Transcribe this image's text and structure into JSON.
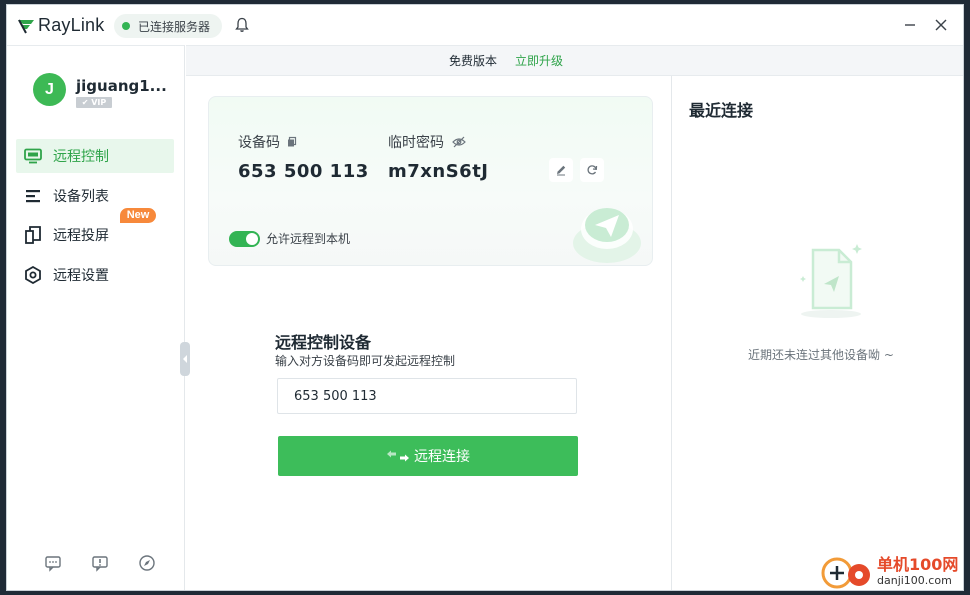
{
  "app": {
    "name": "RayLink",
    "server_status": "已连接服务器",
    "accent": "#33b454"
  },
  "user": {
    "initial": "J",
    "name": "jiguang1...",
    "vip_label": "✔ VIP"
  },
  "sidebar": {
    "items": [
      {
        "label": "远程控制",
        "icon": "monitor-icon",
        "active": true
      },
      {
        "label": "设备列表",
        "icon": "list-icon",
        "active": false
      },
      {
        "label": "远程投屏",
        "icon": "screen-cast-icon",
        "active": false
      },
      {
        "label": "远程设置",
        "icon": "settings-hex-icon",
        "active": false
      }
    ],
    "new_badge": "New",
    "footer_icons": [
      "message-icon",
      "feedback-icon",
      "compass-icon"
    ]
  },
  "version_bar": {
    "version": "免费版本",
    "upgrade": "立即升级"
  },
  "device_card": {
    "code_label": "设备码",
    "code_value": "653 500 113",
    "password_label": "临时密码",
    "password_value": "m7xnS6tJ",
    "allow_label": "允许远程到本机",
    "allow_enabled": true
  },
  "remote_control": {
    "title": "远程控制设备",
    "subtitle": "输入对方设备码即可发起远程控制",
    "input_value": "653 500 113",
    "button_label": "远程连接"
  },
  "recent": {
    "title": "最近连接",
    "empty_text": "近期还未连过其他设备呦 ~"
  },
  "watermark": {
    "main": "单机100网",
    "sub": "danji100.com"
  }
}
